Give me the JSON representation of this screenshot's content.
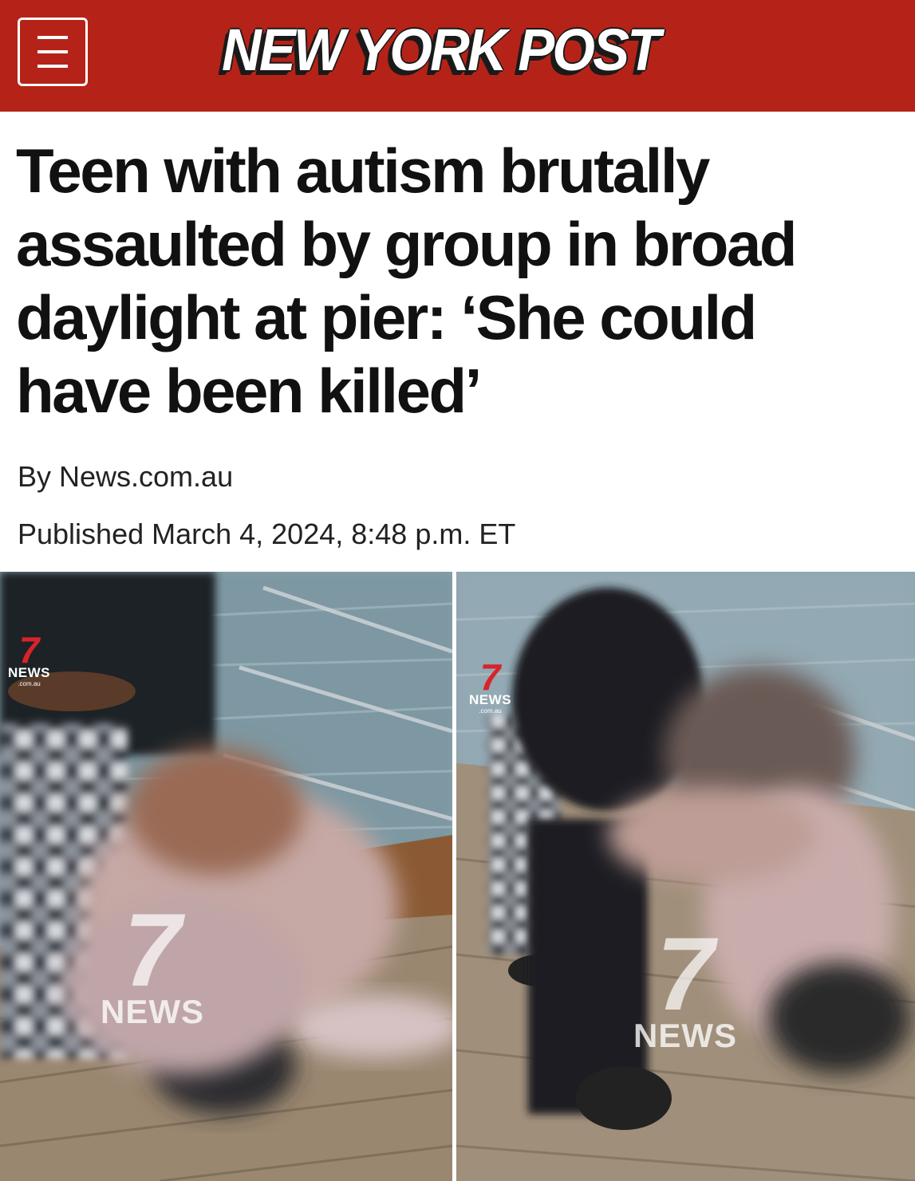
{
  "masthead": {
    "brand": "NEW YORK POST",
    "menu_icon": "hamburger-menu-icon",
    "brand_color": "#b52318"
  },
  "article": {
    "headline": "Teen with autism brutally assaulted by group in broad daylight at pier: ‘She could have been killed’",
    "byline": "By News.com.au",
    "published": "Published March 4, 2024, 8:48 p.m. ET"
  },
  "photos": [
    {
      "watermark_small": {
        "number": "7",
        "label": "NEWS",
        "sub": ".com.au"
      },
      "watermark_large": {
        "number": "7",
        "label": "NEWS"
      }
    },
    {
      "watermark_small": {
        "number": "7",
        "label": "NEWS",
        "sub": ".com.au"
      },
      "watermark_large": {
        "number": "7",
        "label": "NEWS"
      }
    }
  ]
}
